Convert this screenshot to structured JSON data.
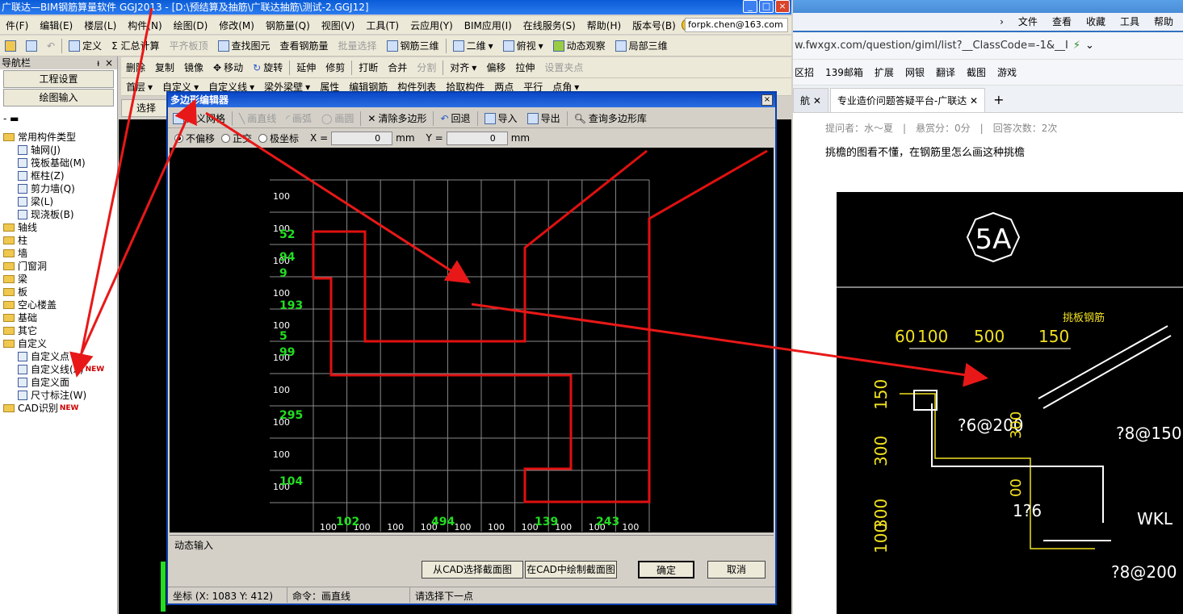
{
  "app": {
    "title": "广联达—BIM钢筋算量软件 GGJ2013 - [D:\\预结算及抽筋\\广联达抽筋\\测试-2.GGJ12]",
    "menus": [
      "件(F)",
      "编辑(E)",
      "楼层(L)",
      "构件(N)",
      "绘图(D)",
      "修改(M)",
      "钢筋量(Q)",
      "视图(V)",
      "工具(T)",
      "云应用(Y)",
      "BIM应用(I)",
      "在线服务(S)",
      "帮助(H)",
      "版本号(B)"
    ],
    "user": "forpk.chen@163.com",
    "toolbar1": [
      "定义",
      "Σ 汇总计算",
      "平齐板顶",
      "查找图元",
      "查看钢筋量",
      "批量选择",
      "钢筋三维",
      "二维",
      "俯视",
      "动态观察",
      "局部三维"
    ],
    "toolbar2": [
      "删除",
      "复制",
      "镜像",
      "移动",
      "旋转",
      "延伸",
      "修剪",
      "打断",
      "合并",
      "分割",
      "对齐",
      "偏移",
      "拉伸",
      "设置夹点"
    ],
    "toolbar3": [
      "首层",
      "自定义",
      "自定义线",
      "梁外梁壁",
      "属性",
      "编辑钢筋",
      "构件列表",
      "拾取构件",
      "两点",
      "平行",
      "点角"
    ],
    "select_label": "选择"
  },
  "nav": {
    "title": "导航栏",
    "pin": "ᵼ",
    "close": "×",
    "btn_project": "工程设置",
    "btn_draw": "绘图输入",
    "tree": [
      {
        "label": "常用构件类型",
        "level": 0,
        "type": "folder"
      },
      {
        "label": "轴网(J)",
        "level": 1,
        "type": "leaf"
      },
      {
        "label": "筏板基础(M)",
        "level": 1,
        "type": "leaf"
      },
      {
        "label": "框柱(Z)",
        "level": 1,
        "type": "leaf"
      },
      {
        "label": "剪力墙(Q)",
        "level": 1,
        "type": "leaf"
      },
      {
        "label": "梁(L)",
        "level": 1,
        "type": "leaf"
      },
      {
        "label": "现浇板(B)",
        "level": 1,
        "type": "leaf"
      },
      {
        "label": "轴线",
        "level": 0,
        "type": "folder"
      },
      {
        "label": "柱",
        "level": 0,
        "type": "folder"
      },
      {
        "label": "墙",
        "level": 0,
        "type": "folder"
      },
      {
        "label": "门窗洞",
        "level": 0,
        "type": "folder"
      },
      {
        "label": "梁",
        "level": 0,
        "type": "folder"
      },
      {
        "label": "板",
        "level": 0,
        "type": "folder"
      },
      {
        "label": "空心楼盖",
        "level": 0,
        "type": "folder"
      },
      {
        "label": "基础",
        "level": 0,
        "type": "folder"
      },
      {
        "label": "其它",
        "level": 0,
        "type": "folder"
      },
      {
        "label": "自定义",
        "level": 0,
        "type": "folder"
      },
      {
        "label": "自定义点",
        "level": 1,
        "type": "leaf"
      },
      {
        "label": "自定义线(X)",
        "level": 1,
        "type": "leaf",
        "badge": "NEW"
      },
      {
        "label": "自定义面",
        "level": 1,
        "type": "leaf"
      },
      {
        "label": "尺寸标注(W)",
        "level": 1,
        "type": "leaf"
      },
      {
        "label": "CAD识别",
        "level": 0,
        "type": "folder",
        "badge": "NEW"
      }
    ]
  },
  "dialog": {
    "title": "多边形编辑器",
    "close": "×",
    "tools": [
      "定义网格",
      "画直线",
      "画弧",
      "画圆",
      "清除多边形",
      "回退",
      "导入",
      "导出",
      "查询多边形库"
    ],
    "tools_disabled": [
      false,
      true,
      true,
      true,
      false,
      false,
      false,
      false,
      false
    ],
    "modes": [
      "不偏移",
      "正交",
      "极坐标"
    ],
    "mode_selected": 0,
    "x_label": "X =",
    "y_label": "Y =",
    "x_value": "0",
    "y_value": "0",
    "unit": "mm",
    "grid_left_labels": [
      "100",
      "100",
      "100",
      "100",
      "100",
      "100",
      "100",
      "100",
      "100",
      "100"
    ],
    "grid_left_green": [
      "52",
      "94",
      "9",
      "193",
      "5",
      "99",
      "295",
      "104"
    ],
    "grid_bottom_labels": [
      "100",
      "100",
      "100",
      "100",
      "100",
      "100",
      "100",
      "100",
      "100",
      "100"
    ],
    "grid_bottom_green": [
      "102",
      "494",
      "139",
      "243"
    ],
    "dynamic_input": "动态输入",
    "btn_from_cad": "从CAD选择截面图",
    "btn_draw_cad": "在CAD中绘制截面图",
    "btn_ok": "确定",
    "btn_cancel": "取消",
    "status_coord": "坐标 (X: 1083 Y: 412)",
    "status_cmd": "命令：画直线",
    "status_prompt": "请选择下一点"
  },
  "browser": {
    "menu": [
      "文件",
      "查看",
      "收藏",
      "工具",
      "帮助"
    ],
    "url": "w.fwxgx.com/question/giml/list?__ClassCode=-1&__I",
    "fav": [
      "区招",
      "139邮箱",
      "扩展",
      "网银",
      "翻译",
      "截图",
      "游戏"
    ],
    "tabs": [
      "航",
      "专业造价问题答疑平台-广联达"
    ],
    "new_tab": "+",
    "meta": "提问者：水～夏　|　悬赏分：0分　|　回答次数：2次",
    "question": "挑檐的图看不懂，在钢筋里怎么画这种挑檐",
    "cad": {
      "tag": "5A",
      "dims_top": [
        "60",
        "100",
        "500",
        "150"
      ],
      "label_slab": "挑板钢筋",
      "dims_left": [
        "150",
        "300",
        "300",
        "100"
      ],
      "rebar1": "?6@200",
      "rebar2": "?8@150",
      "rebar3": "1?6",
      "rebar4": "?8@200",
      "beam": "WKL",
      "dim_mid1": "300",
      "dim_mid2": "00"
    }
  },
  "colors": {
    "accent": "#0a48c8",
    "grid": "#8a8a8a",
    "poly": "#e01010",
    "green": "#22dd22",
    "arrow": "#e81818"
  }
}
